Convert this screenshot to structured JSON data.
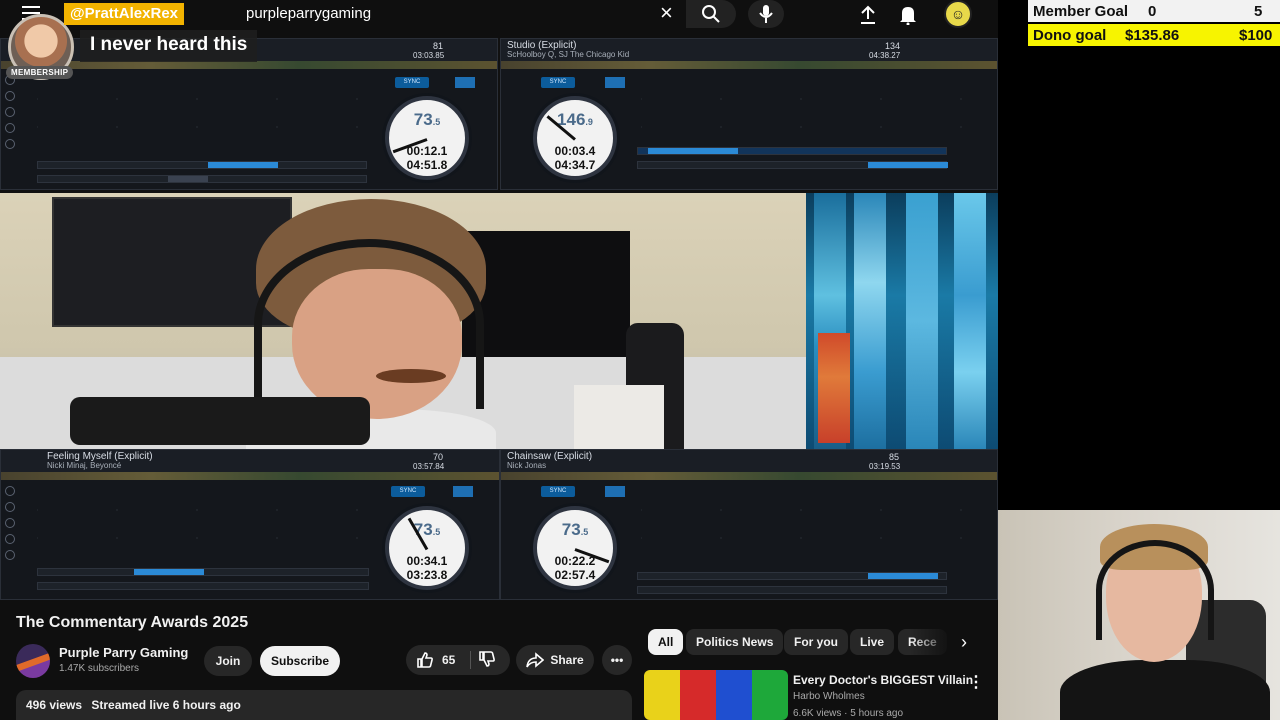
{
  "search": {
    "query": "purpleparrygaming"
  },
  "chat": {
    "username": "@PrattAlexRex",
    "badge": "MEMBERSHIP",
    "message": "I never heard this"
  },
  "decks": {
    "top_left": {
      "bpm": "81",
      "time": "03:03.85"
    },
    "top_right": {
      "title": "Studio (Explicit)",
      "artist": "ScHoolboy Q, SJ The Chicago Kid",
      "bpm": "134",
      "time": "04:38.27"
    },
    "bottom_left": {
      "title": "Feeling Myself (Explicit)",
      "artist": "Nicki Minaj, Beyoncé",
      "bpm": "70",
      "time": "03:57.84"
    },
    "bottom_right": {
      "title": "Chainsaw (Explicit)",
      "artist": "Nick Jonas",
      "bpm": "85",
      "time": "03:19.53"
    }
  },
  "jogs": [
    {
      "bpm": "73",
      "bpm_dec": ".5",
      "elapsed": "00:12.1",
      "remain": "04:51.8"
    },
    {
      "bpm": "146",
      "bpm_dec": ".9",
      "elapsed": "00:03.4",
      "remain": "04:34.7"
    },
    {
      "bpm": "73",
      "bpm_dec": ".5",
      "elapsed": "00:34.1",
      "remain": "03:23.8"
    },
    {
      "bpm": "73",
      "bpm_dec": ".5",
      "elapsed": "00:22.2",
      "remain": "02:57.4"
    }
  ],
  "video": {
    "title": "The Commentary Awards 2025",
    "channel": "Purple Parry Gaming",
    "subscribers": "1.47K subscribers",
    "join_label": "Join",
    "subscribe_label": "Subscribe",
    "likes": "65",
    "share_label": "Share",
    "views": "496 views",
    "streamed": "Streamed live 6 hours ago"
  },
  "chips": [
    "All",
    "Politics News",
    "For you",
    "Live",
    "Rece"
  ],
  "related": {
    "title": "Every Doctor's BIGGEST Villain",
    "channel": "Harbo Wholmes",
    "meta": "6.6K views · 5 hours ago"
  },
  "goals": {
    "member": {
      "label": "Member Goal",
      "current": "0",
      "target": "5"
    },
    "dono": {
      "label": "Dono goal",
      "current": "$135.86",
      "target": "$100"
    }
  },
  "colors": {
    "member_name_bg": "#f2b300",
    "dono_goal_bg": "#f7f400",
    "deck_accent": "#2b8ad6"
  }
}
